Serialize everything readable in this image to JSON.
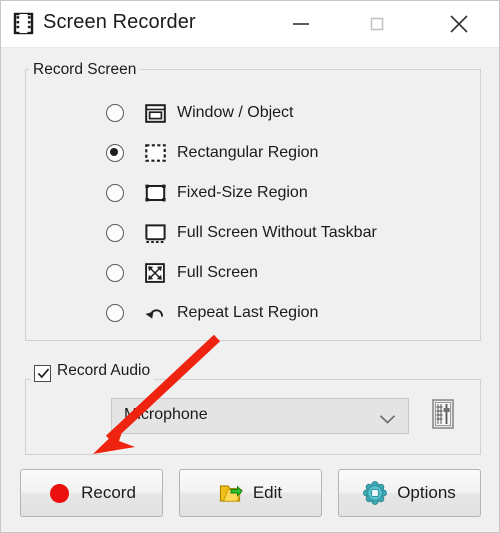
{
  "window": {
    "title": "Screen Recorder",
    "app_icon": "film-strip-icon",
    "controls": {
      "minimize_label": "Minimize",
      "maximize_label": "Maximize",
      "close_label": "Close"
    }
  },
  "record_screen_group": {
    "legend": "Record Screen",
    "options": [
      {
        "label": "Window / Object",
        "icon": "window-object-icon",
        "selected": false
      },
      {
        "label": "Rectangular Region",
        "icon": "dashed-rectangle-icon",
        "selected": true
      },
      {
        "label": "Fixed-Size Region",
        "icon": "fixed-rectangle-icon",
        "selected": false
      },
      {
        "label": "Full Screen Without Taskbar",
        "icon": "screen-no-taskbar-icon",
        "selected": false
      },
      {
        "label": "Full Screen",
        "icon": "fullscreen-arrows-icon",
        "selected": false
      },
      {
        "label": "Repeat Last Region",
        "icon": "repeat-arrow-icon",
        "selected": false
      }
    ]
  },
  "record_audio_group": {
    "legend": "Record Audio",
    "checked": true,
    "device": {
      "selected": "Microphone",
      "options": [
        "Microphone"
      ]
    },
    "settings_button_icon": "audio-mixer-icon"
  },
  "actions": [
    {
      "label": "Record",
      "icon": "red-record-dot-icon"
    },
    {
      "label": "Edit",
      "icon": "folder-edit-icon"
    },
    {
      "label": "Options",
      "icon": "gear-icon"
    }
  ],
  "annotation": {
    "type": "arrow",
    "color": "#ee2411",
    "points_to": "Record",
    "from": [
      216,
      337
    ],
    "to": [
      92,
      453
    ]
  },
  "colors": {
    "window_background": "#f0f0f0",
    "titlebar_background": "#ffffff",
    "accent_record": "#ec0f0f",
    "annotation_red": "#ee2411",
    "group_border": "#d2d2d2",
    "combo_background": "#e4e4e4"
  }
}
